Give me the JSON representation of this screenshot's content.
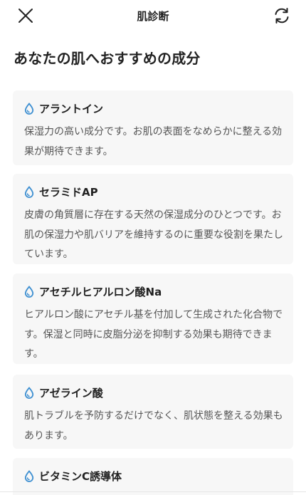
{
  "header": {
    "title": "肌診断",
    "close_icon": "close-icon",
    "refresh_icon": "refresh-icon"
  },
  "section": {
    "title": "あなたの肌へおすすめの成分"
  },
  "ingredients": [
    {
      "name": "アラントイン",
      "description": "保湿力の高い成分です。お肌の表面をなめらかに整える効果が期待できます。"
    },
    {
      "name": "セラミドAP",
      "description": "皮膚の角質層に存在する天然の保湿成分のひとつです。お肌の保湿力や肌バリアを維持するのに重要な役割を果たしています。"
    },
    {
      "name": "アセチルヒアルロン酸Na",
      "description": "ヒアルロン酸にアセチル基を付加して生成された化合物です。保湿と同時に皮脂分泌を抑制する効果も期待できます。"
    },
    {
      "name": "アゼライン酸",
      "description": "肌トラブルを予防するだけでなく、肌状態を整える効果もあります。"
    },
    {
      "name": "ビタミンC誘導体",
      "description": ""
    }
  ],
  "colors": {
    "drop_icon": "#3d8fd1",
    "card_bg": "#f7f7f7",
    "text_primary": "#222222",
    "text_secondary": "#555555"
  }
}
